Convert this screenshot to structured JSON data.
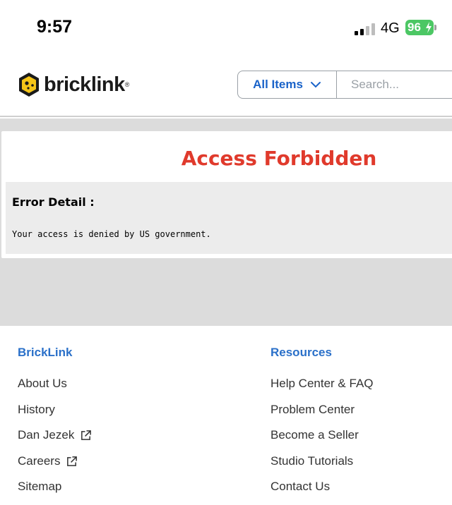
{
  "status_bar": {
    "time": "9:57",
    "network": "4G",
    "battery": "96"
  },
  "header": {
    "logo_text": "bricklink",
    "category": "All Items",
    "search_placeholder": "Search..."
  },
  "error": {
    "title": "Access Forbidden",
    "detail_label": "Error Detail :",
    "message": "Your access is denied by US government."
  },
  "footer": {
    "bricklink": {
      "heading": "BrickLink",
      "links": [
        "About Us",
        "History",
        "Dan Jezek",
        "Careers",
        "Sitemap"
      ]
    },
    "resources": {
      "heading": "Resources",
      "links": [
        "Help Center & FAQ",
        "Problem Center",
        "Become a Seller",
        "Studio Tutorials",
        "Contact Us"
      ]
    }
  },
  "colors": {
    "accent": "#2a70c9",
    "error": "#e03a2c",
    "battery": "#4cc764",
    "logo_yellow": "#f5c518"
  }
}
